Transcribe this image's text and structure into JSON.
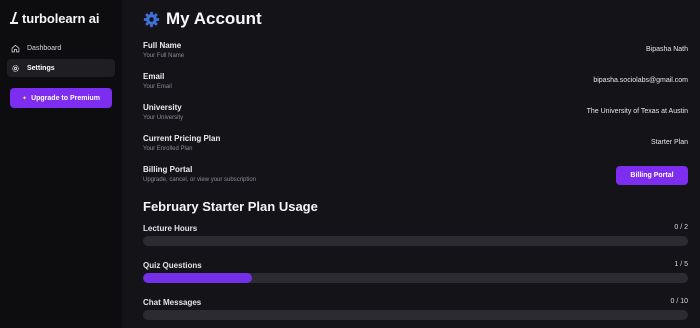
{
  "brand": {
    "name": "turbolearn ai"
  },
  "sidebar": {
    "items": [
      {
        "label": "Dashboard",
        "icon": "home-icon",
        "active": false
      },
      {
        "label": "Settings",
        "icon": "gear-icon",
        "active": true
      }
    ],
    "upgrade_label": "Upgrade to Premium"
  },
  "page": {
    "title": "My Account"
  },
  "account": {
    "full_name": {
      "label": "Full Name",
      "sub": "Your Full Name",
      "value": "Bipasha Nath"
    },
    "email": {
      "label": "Email",
      "sub": "Your Email",
      "value": "bipasha.sociolabs@gmail.com"
    },
    "university": {
      "label": "University",
      "sub": "Your University",
      "value": "The University of Texas at Austin"
    },
    "plan": {
      "label": "Current Pricing Plan",
      "sub": "Your Enrolled Plan",
      "value": "Starter Plan"
    },
    "billing": {
      "label": "Billing Portal",
      "sub": "Upgrade, cancel, or view your subscription",
      "button": "Billing Portal"
    }
  },
  "usage": {
    "title": "February Starter Plan Usage",
    "items": [
      {
        "label": "Lecture Hours",
        "count": "0 / 2",
        "used": 0,
        "limit": 2
      },
      {
        "label": "Quiz Questions",
        "count": "1 / 5",
        "used": 1,
        "limit": 5
      },
      {
        "label": "Chat Messages",
        "count": "0 / 10",
        "used": 0,
        "limit": 10
      }
    ]
  },
  "colors": {
    "accent": "#7c2df0",
    "background": "#141418",
    "sidebar": "#0d0d10",
    "track": "#2b2b31"
  }
}
